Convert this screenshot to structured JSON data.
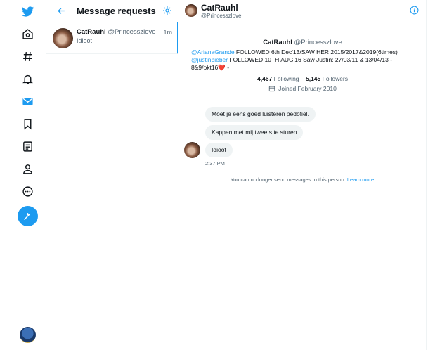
{
  "sidebar": {
    "icons": [
      "twitter-logo-icon",
      "home-icon",
      "explore-hashtag-icon",
      "notifications-bell-icon",
      "messages-envelope-icon",
      "bookmarks-icon",
      "lists-icon",
      "profile-icon",
      "more-icon"
    ],
    "compose_icon": "compose-tweet-icon"
  },
  "requests": {
    "title": "Message requests",
    "items": [
      {
        "name": "CatRauhl",
        "handle": "@Princesszlove",
        "time": "1m",
        "preview": "Idioot"
      }
    ]
  },
  "conversation": {
    "header": {
      "name": "CatRauhl",
      "handle": "@Princesszlove"
    },
    "profile": {
      "name": "CatRauhl",
      "handle": "@Princesszlove",
      "bio_mention1": "@ArianaGrande",
      "bio_text1": " FOLLOWED 6th Dec'13/SAW HER 2015/2017&2019(6times)",
      "bio_mention2": "@justinbieber",
      "bio_text2": " FOLLOWED 10TH AUG'16 Saw Justin: 27/03/11 & 13/04/13 - 8&9/okt16",
      "bio_heart": "❤️",
      "bio_text3": " -",
      "following_count": "4,467",
      "following_label": "Following",
      "followers_count": "5,145",
      "followers_label": "Followers",
      "joined": "Joined February 2010"
    },
    "messages": [
      {
        "text": "Moet je eens goed luisteren pedofiel."
      },
      {
        "text": "Kappen met mij tweets te sturen"
      },
      {
        "text": "Idioot"
      }
    ],
    "last_time": "2:37 PM",
    "notice": "You can no longer send messages to this person.",
    "learn_more": "Learn more"
  },
  "colors": {
    "accent": "#1d9bf0",
    "text": "#0f1419",
    "muted": "#536471",
    "bubble": "#eff3f4"
  }
}
